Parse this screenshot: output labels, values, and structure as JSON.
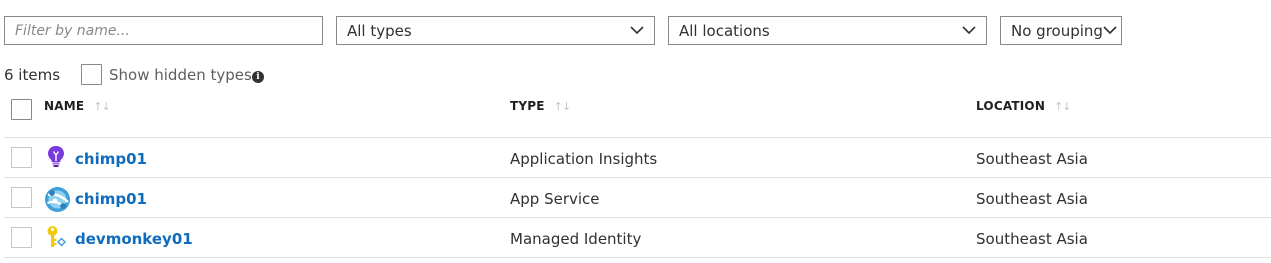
{
  "filter": {
    "search_placeholder": "Filter by name...",
    "type_select": "All types",
    "location_select": "All locations",
    "grouping_select": "No grouping"
  },
  "summary": {
    "count_text": "6 items",
    "show_hidden_label": "Show hidden types"
  },
  "table": {
    "columns": {
      "name": "NAME",
      "type": "TYPE",
      "location": "LOCATION"
    },
    "rows": [
      {
        "name": "chimp01",
        "type": "Application Insights",
        "location": "Southeast Asia",
        "icon": "application-insights-icon"
      },
      {
        "name": "chimp01",
        "type": "App Service",
        "location": "Southeast Asia",
        "icon": "app-service-icon"
      },
      {
        "name": "devmonkey01",
        "type": "Managed Identity",
        "location": "Southeast Asia",
        "icon": "managed-identity-icon"
      }
    ]
  },
  "colors": {
    "link": "#0f6cbd",
    "border": "#8a8886",
    "divider": "#e1dfdd"
  }
}
